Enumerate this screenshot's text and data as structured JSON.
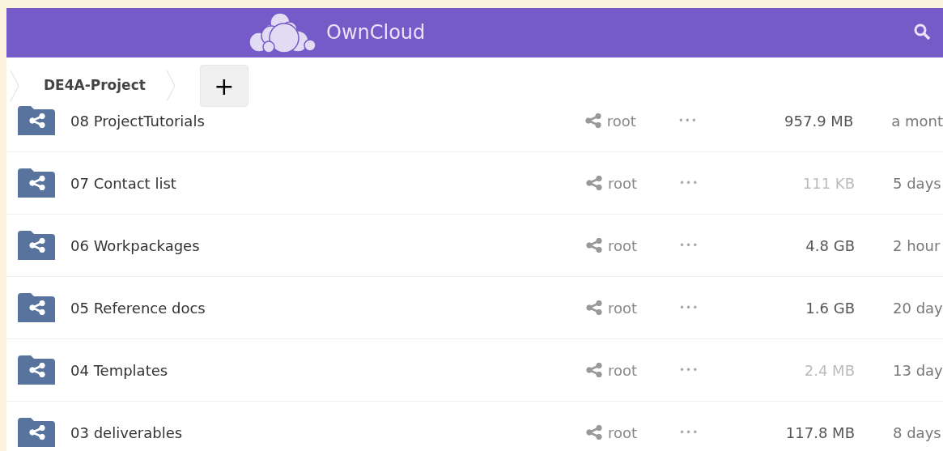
{
  "header": {
    "title": "OwnCloud"
  },
  "breadcrumb": {
    "items": [
      "DE4A-Project"
    ],
    "add_button": "+"
  },
  "files": [
    {
      "name": "08 ProjectTutorials",
      "owner": "root",
      "actions": "•••",
      "size": "957.9 MB",
      "faint_size": false,
      "modified": "a mont"
    },
    {
      "name": "07 Contact list",
      "owner": "root",
      "actions": "•••",
      "size": "111 KB",
      "faint_size": true,
      "modified": "5 days"
    },
    {
      "name": "06 Workpackages",
      "owner": "root",
      "actions": "•••",
      "size": "4.8 GB",
      "faint_size": false,
      "modified": "2 hour"
    },
    {
      "name": "05 Reference docs",
      "owner": "root",
      "actions": "•••",
      "size": "1.6 GB",
      "faint_size": false,
      "modified": "20 day"
    },
    {
      "name": "04 Templates",
      "owner": "root",
      "actions": "•••",
      "size": "2.4 MB",
      "faint_size": true,
      "modified": "13 day"
    },
    {
      "name": "03 deliverables",
      "owner": "root",
      "actions": "•••",
      "size": "117.8 MB",
      "faint_size": false,
      "modified": "8 days"
    }
  ]
}
